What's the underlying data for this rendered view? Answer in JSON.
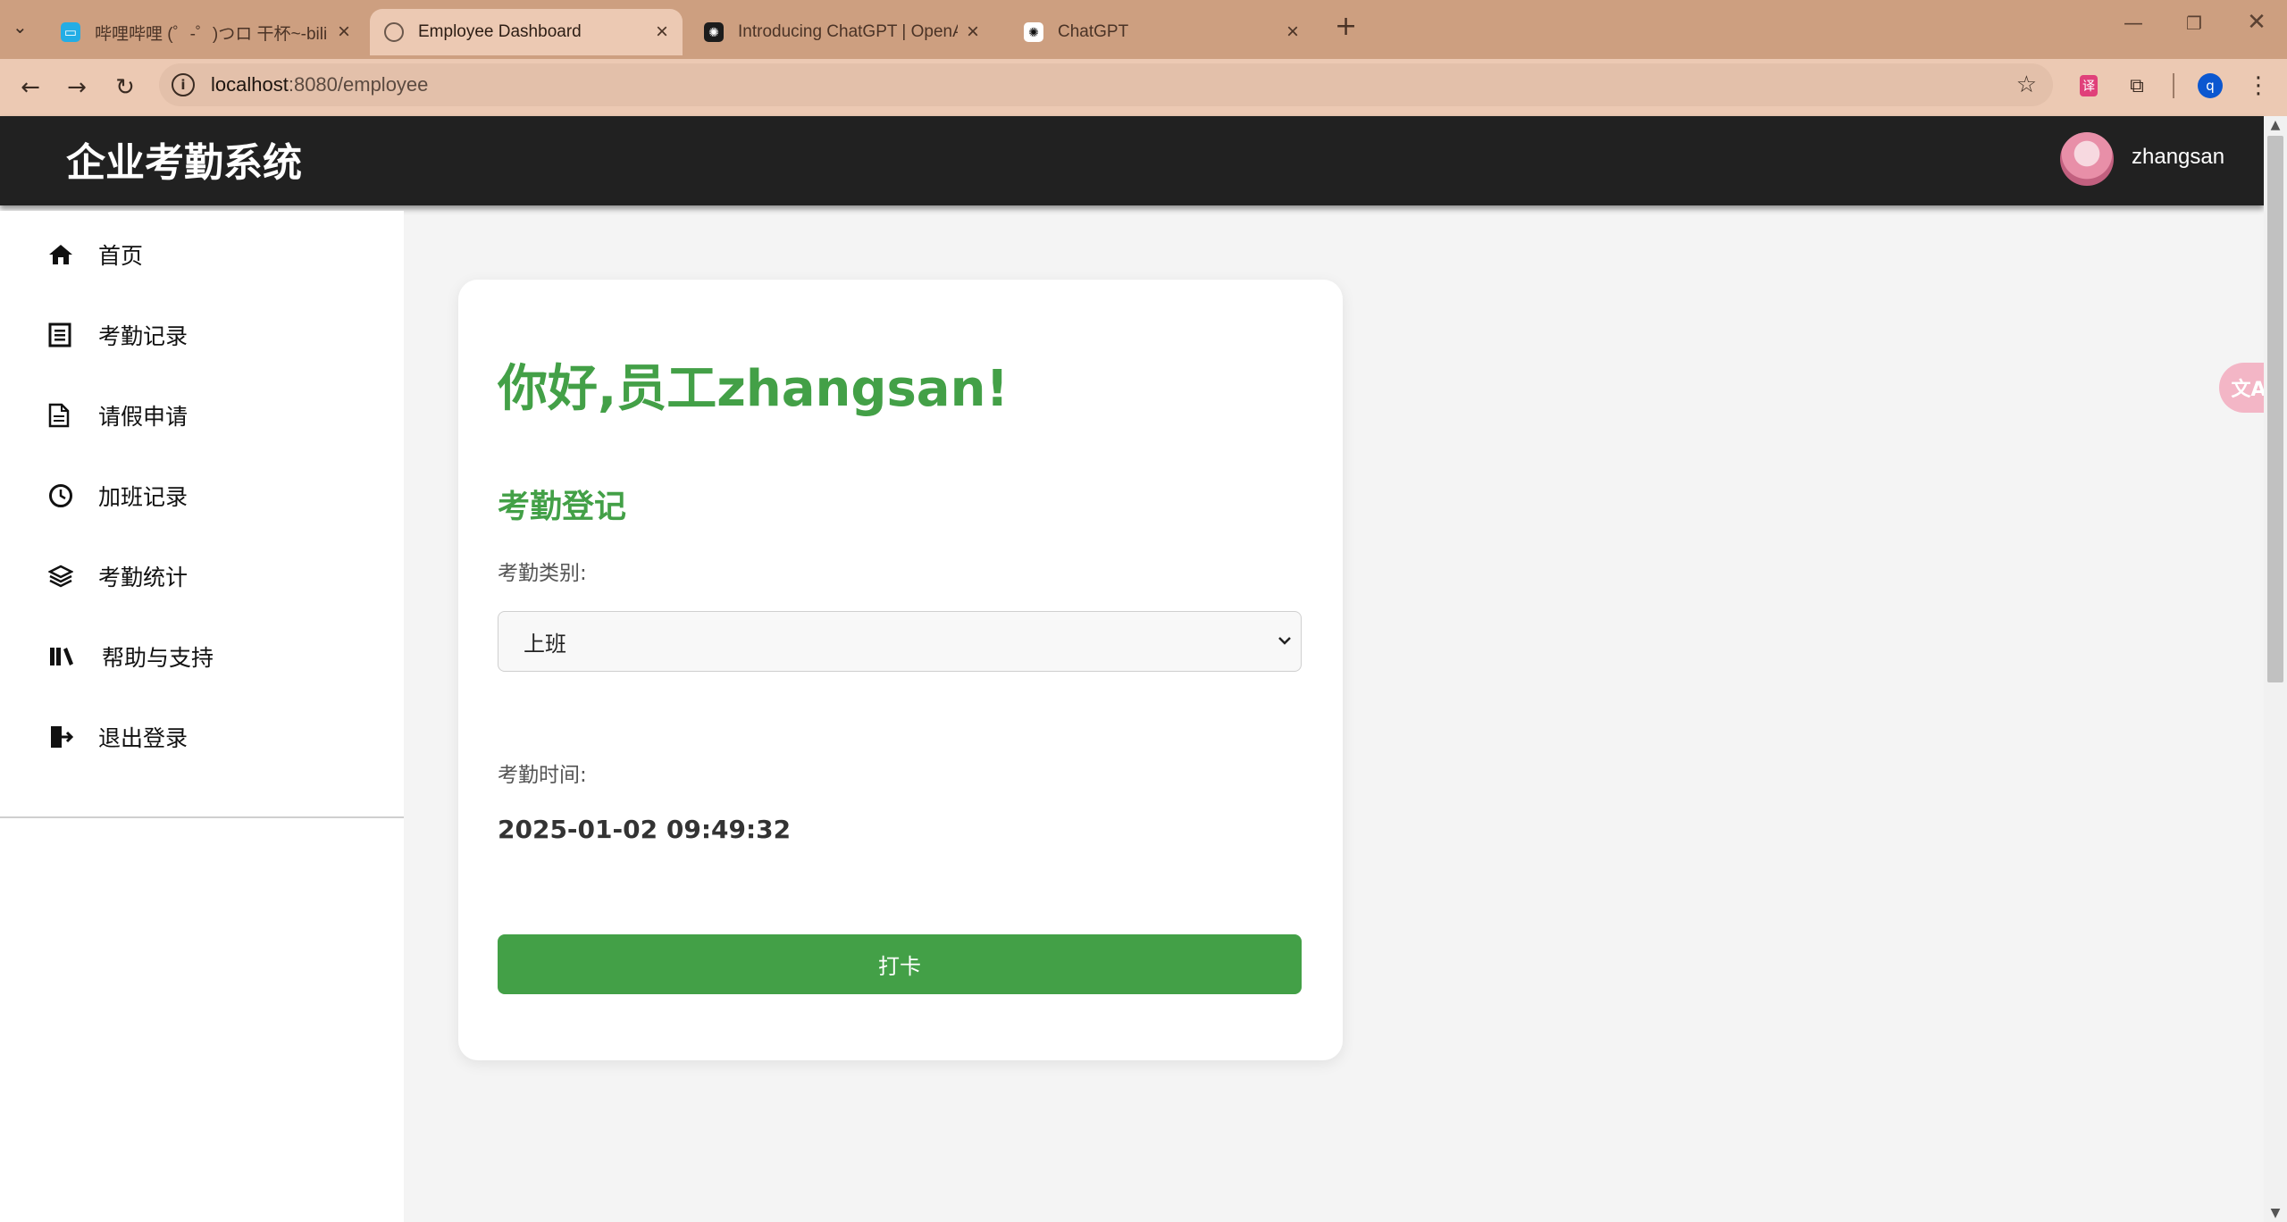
{
  "browser": {
    "tabs": [
      {
        "title": "哔哩哔哩 (゜-゜)つロ 干杯~-bili",
        "icon": "bilibili-icon"
      },
      {
        "title": "Employee Dashboard",
        "icon": "globe-icon"
      },
      {
        "title": "Introducing ChatGPT | OpenAI",
        "icon": "openai-icon"
      },
      {
        "title": "ChatGPT",
        "icon": "openai-icon"
      }
    ],
    "new_tab_label": "+",
    "url_host": "localhost",
    "url_path": ":8080/employee",
    "profile_initial": "q"
  },
  "header": {
    "app_title": "企业考勤系统",
    "user_name": "zhangsan"
  },
  "sidebar": {
    "items": [
      {
        "label": "首页",
        "icon": "home-icon"
      },
      {
        "label": "考勤记录",
        "icon": "list-icon"
      },
      {
        "label": "请假申请",
        "icon": "document-icon"
      },
      {
        "label": "加班记录",
        "icon": "clock-icon"
      },
      {
        "label": "考勤统计",
        "icon": "layers-icon"
      },
      {
        "label": "帮助与支持",
        "icon": "books-icon"
      },
      {
        "label": "退出登录",
        "icon": "logout-icon"
      }
    ]
  },
  "main": {
    "greeting": "你好,员工zhangsan!",
    "section_title": "考勤登记",
    "type_label": "考勤类别:",
    "type_value": "上班",
    "time_label": "考勤时间:",
    "time_value": "2025-01-02 09:49:32",
    "punch_label": "打卡"
  },
  "colors": {
    "accent": "#43a047",
    "header_bg": "#212121",
    "chrome_tab": "#cd9f80"
  }
}
